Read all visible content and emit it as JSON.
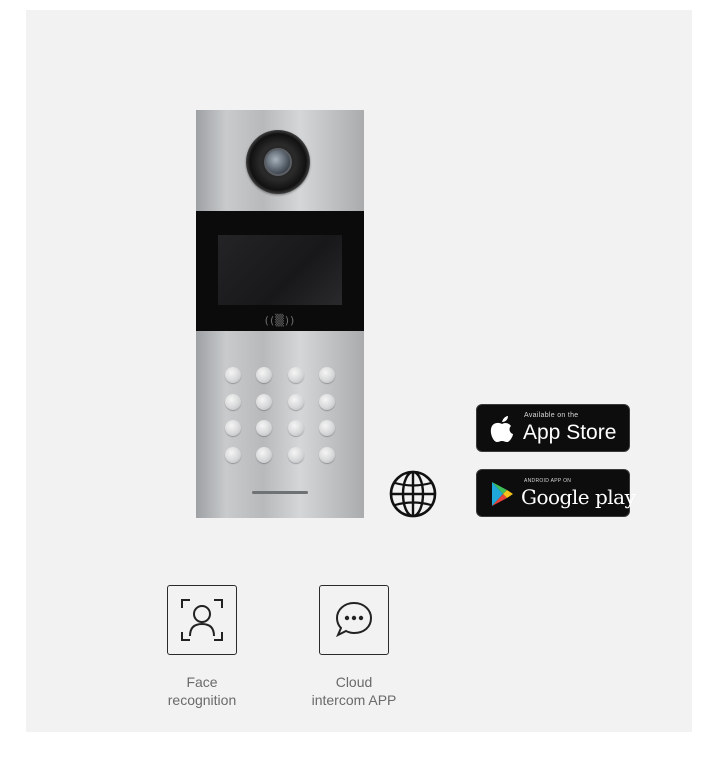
{
  "device": {
    "rfid_label": "((▒))"
  },
  "store_badges": {
    "app_store": {
      "small_text": "Available on the",
      "big_text": "App Store",
      "icon": "apple-icon"
    },
    "google_play": {
      "small_text": "ANDROID APP ON",
      "big_text": "Google play",
      "icon": "play-triangle-icon"
    }
  },
  "globe_icon": "globe-icon",
  "features": [
    {
      "label_line1": "Face",
      "label_line2": "recognition",
      "icon": "face-scan-icon"
    },
    {
      "label_line1": "Cloud",
      "label_line2": "intercom APP",
      "icon": "chat-bubble-icon"
    }
  ],
  "colors": {
    "card_background": "#f2f2f2",
    "badge_background": "#0d0d0d",
    "label_text": "#6a6a6a"
  }
}
